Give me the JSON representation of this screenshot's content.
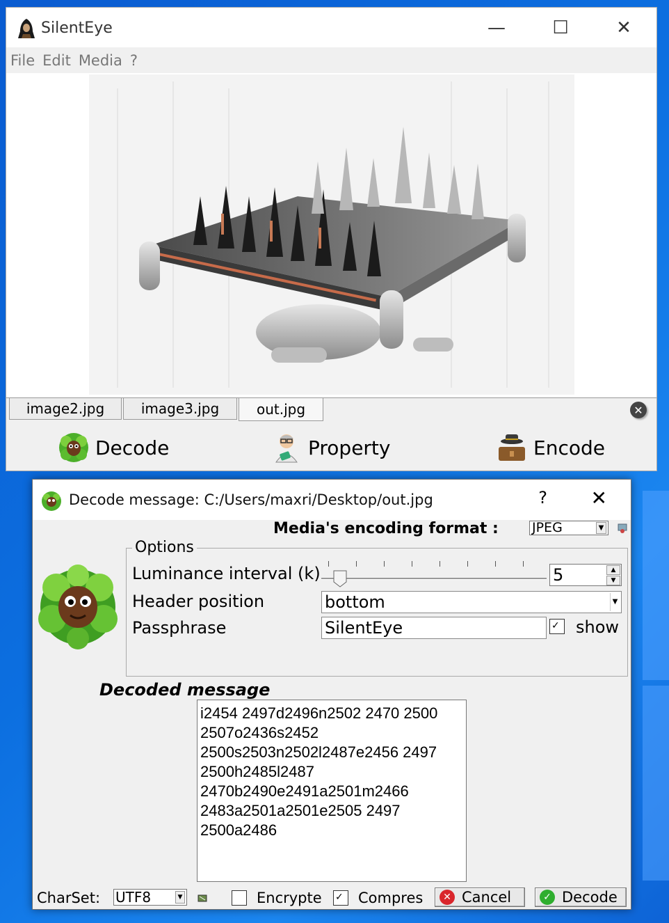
{
  "main_window": {
    "title": "SilentEye",
    "minimize_glyph": "—",
    "maximize_glyph": "☐",
    "close_glyph": "✕",
    "menu": [
      "File",
      "Edit",
      "Media",
      "?"
    ],
    "tabs": [
      "image2.jpg",
      "image3.jpg",
      "out.jpg"
    ],
    "active_tab": "out.jpg",
    "actions": {
      "decode": "Decode",
      "property": "Property",
      "encode": "Encode"
    }
  },
  "dialog": {
    "title": "Decode message: C:/Users/maxri/Desktop/out.jpg",
    "help_glyph": "?",
    "close_glyph": "✕",
    "format_label": "Media's encoding format :",
    "format_value": "JPEG",
    "options": {
      "legend": "Options",
      "luminance_label": "Luminance interval (k)",
      "luminance_value": "5",
      "header_label": "Header position",
      "header_value": "bottom",
      "passphrase_label": "Passphrase",
      "passphrase_value": "SilentEye",
      "show_label": "show",
      "show_checked": true
    },
    "decoded_label": "Decoded message",
    "decoded_lines": [
      "i2454 2497d2496n2502 2470 2500",
      "2507o2436s2452",
      "2500s2503n2502l2487e2456 2497",
      "2500h2485l2487",
      "2470b2490e2491a2501m2466",
      "2483a2501a2501e2505 2497",
      "2500a2486"
    ],
    "bottom": {
      "charset_label": "CharSet:",
      "charset_value": "UTF8",
      "encrypted_label": "Encrypte",
      "encrypted_checked": false,
      "compress_label": "Compres",
      "compress_checked": true,
      "cancel_label": "Cancel",
      "decode_label": "Decode"
    }
  },
  "colors": {
    "desktop": "#0c6fe0",
    "cancel_icon": "#d9262c",
    "decode_icon": "#2fae2f"
  }
}
